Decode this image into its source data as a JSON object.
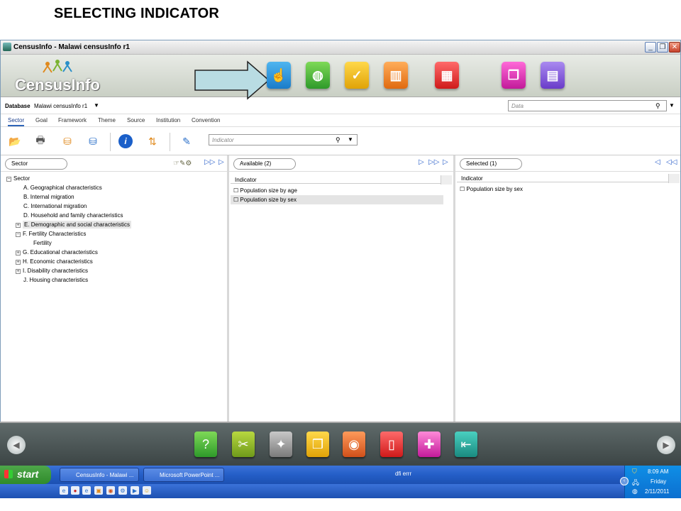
{
  "slide_title": "SELECTING INDICATOR",
  "window": {
    "title": "CensusInfo  - Malawi censusInfo r1",
    "logo": "CensusInfo",
    "minimize": "_",
    "restore": "❐",
    "close": "✕"
  },
  "database": {
    "label": "Database",
    "value": "Malawi censusInfo r1",
    "data_placeholder": "Data"
  },
  "tabs": [
    "Sector",
    "Goal",
    "Framework",
    "Theme",
    "Source",
    "Institution",
    "Convention"
  ],
  "indicator_placeholder": "Indicator",
  "left_pane": {
    "pill": "Sector",
    "tree": [
      {
        "label": "Sector",
        "level": 0,
        "toggle": "−"
      },
      {
        "label": "A. Geographical characteristics",
        "level": 1,
        "toggle": ""
      },
      {
        "label": "B. Internal migration",
        "level": 1,
        "toggle": ""
      },
      {
        "label": "C. International migration",
        "level": 1,
        "toggle": ""
      },
      {
        "label": "D. Household and family characteristics",
        "level": 1,
        "toggle": ""
      },
      {
        "label": "E. Demographic and social characteristics",
        "level": 1,
        "toggle": "+"
      },
      {
        "label": "F. Fertility Characteristics",
        "level": 1,
        "toggle": "−"
      },
      {
        "label": "Fertility",
        "level": 2,
        "toggle": ""
      },
      {
        "label": "G. Educational characteristics",
        "level": 1,
        "toggle": "+"
      },
      {
        "label": "H. Economic characteristics",
        "level": 1,
        "toggle": "+"
      },
      {
        "label": "I. Disability characteristics",
        "level": 1,
        "toggle": "+"
      },
      {
        "label": "J. Housing characteristics",
        "level": 1,
        "toggle": ""
      }
    ]
  },
  "middle_pane": {
    "pill": "Available (2)",
    "column_header": "Indicator",
    "rows": [
      "Population size by age",
      "Population size by sex"
    ]
  },
  "right_pane": {
    "pill": "Selected (1)",
    "column_header": "Indicator",
    "rows": [
      "Population size by sex"
    ]
  },
  "taskbar": {
    "start": "start",
    "tasks": [
      "CensusInfo  - Malawi ...",
      "Microsoft PowerPoint ..."
    ],
    "center_text": "dfi errr",
    "time": "8:09 AM",
    "day": "Friday",
    "date": "2/11/2011"
  },
  "colors": {
    "accent": "#2e64b8",
    "arrow_fill": "#b9dce3",
    "taskbar": "#245ec7",
    "start": "#3c9a38"
  }
}
